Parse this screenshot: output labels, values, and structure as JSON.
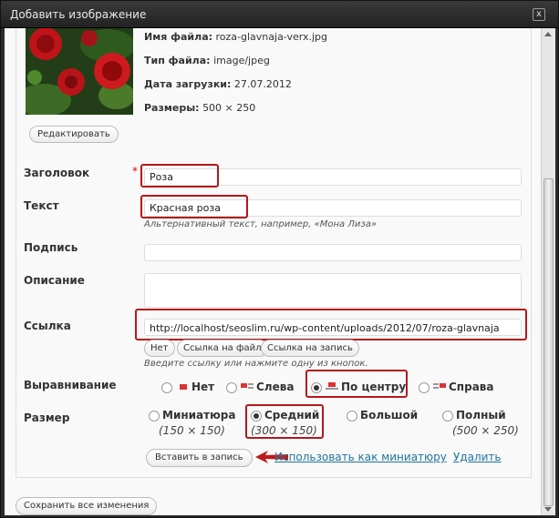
{
  "window": {
    "title": "Добавить изображение",
    "close_glyph": "x"
  },
  "file": {
    "name_label": "Имя файла:",
    "name_value": "roza-glavnaja-verx.jpg",
    "type_label": "Тип файла:",
    "type_value": "image/jpeg",
    "date_label": "Дата загрузки:",
    "date_value": "27.07.2012",
    "size_label": "Размеры:",
    "size_value": "500 × 250",
    "edit_button": "Редактировать"
  },
  "form": {
    "title_label": "Заголовок",
    "title_value": "Роза",
    "required_mark": "*",
    "alt_label": "Текст",
    "alt_value": "Красная  роза",
    "alt_hint": "Альтернативный текст, например, «Мона Лиза»",
    "caption_label": "Подпись",
    "caption_value": "",
    "description_label": "Описание",
    "description_value": "",
    "link_label": "Ссылка",
    "link_value": "http://localhost/seoslim.ru/wp-content/uploads/2012/07/roza-glavnaja",
    "link_buttons": [
      "Нет",
      "Ссылка на файл",
      "Ссылка на запись"
    ],
    "link_hint": "Введите ссылку или нажмите одну из кнопок."
  },
  "alignment": {
    "label": "Выравнивание",
    "options": [
      "Нет",
      "Слева",
      "По центру",
      "Справа"
    ],
    "selected": "По центру"
  },
  "size": {
    "label": "Размер",
    "options": [
      {
        "name": "Миниатюра",
        "dims": "(150 × 150)"
      },
      {
        "name": "Средний",
        "dims": "(300 × 150)"
      },
      {
        "name": "Большой",
        "dims": ""
      },
      {
        "name": "Полный",
        "dims": "(500 × 250)"
      }
    ],
    "selected": "Средний"
  },
  "actions": {
    "insert_button": "Вставить в запись",
    "use_thumbnail_link": "Использовать как миниатюру",
    "delete_link": "Удалить",
    "save_all_button": "Сохранить  все изменения"
  },
  "colors": {
    "highlight": "#b3181c",
    "link": "#21759b",
    "required": "#dd0000"
  }
}
